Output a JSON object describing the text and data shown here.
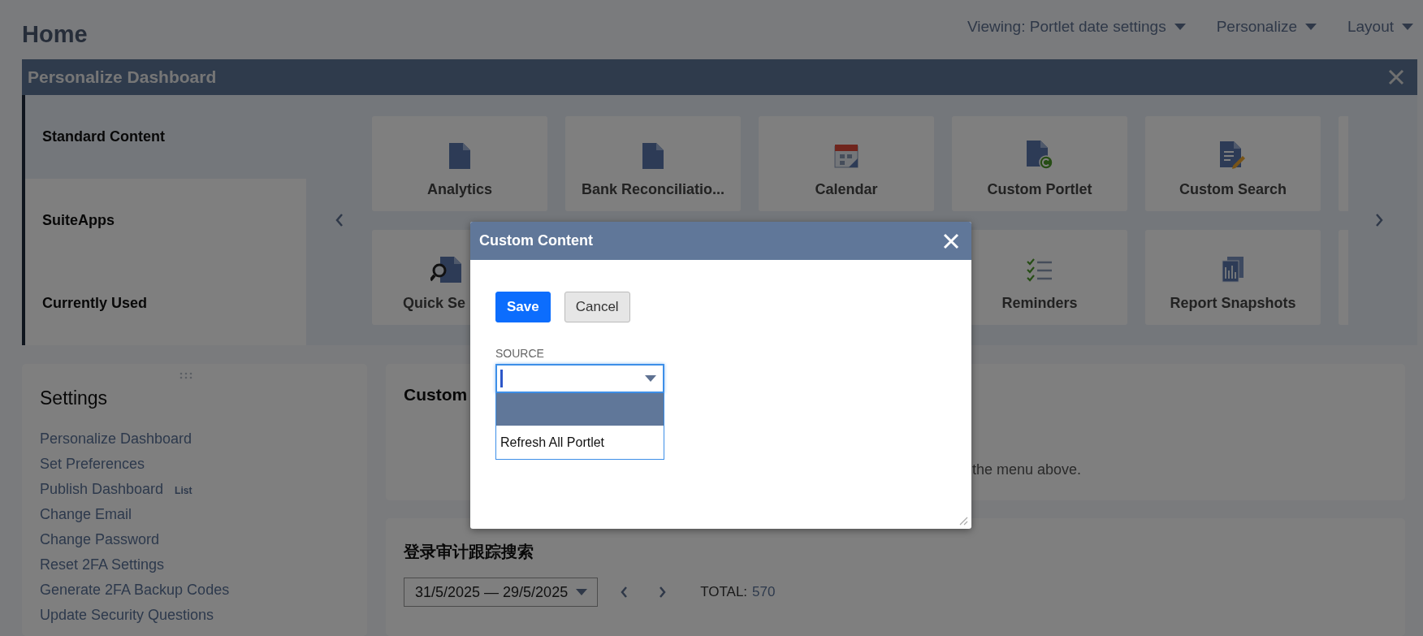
{
  "page": {
    "title": "Home",
    "menus": [
      {
        "label": "Viewing: Portlet date settings"
      },
      {
        "label": "Personalize"
      },
      {
        "label": "Layout"
      }
    ]
  },
  "personalize_panel": {
    "title": "Personalize Dashboard",
    "categories": [
      {
        "label": "Standard Content",
        "selected": true
      },
      {
        "label": "SuiteApps",
        "selected": false
      },
      {
        "label": "Currently Used",
        "selected": false
      }
    ],
    "tiles_row_1": [
      {
        "label": "Analytics",
        "kind": "document"
      },
      {
        "label": "Bank Reconciliatio...",
        "kind": "document"
      },
      {
        "label": "Calendar",
        "kind": "calendar"
      },
      {
        "label": "Custom Portlet",
        "kind": "badge"
      },
      {
        "label": "Custom Search",
        "kind": "pencil"
      }
    ],
    "tiles_row_2": [
      {
        "label": "Quick Se",
        "kind": "search"
      },
      {
        "label": "Reminders",
        "kind": "checklist"
      },
      {
        "label": "Report Snapshots",
        "kind": "stack"
      }
    ]
  },
  "settings_portlet": {
    "title": "Settings",
    "links": [
      {
        "label": "Personalize Dashboard"
      },
      {
        "label": "Set Preferences"
      },
      {
        "label": "Publish Dashboard",
        "tag": "List"
      },
      {
        "label": "Change Email"
      },
      {
        "label": "Change Password"
      },
      {
        "label": "Reset 2FA Settings"
      },
      {
        "label": "Generate 2FA Backup Codes"
      },
      {
        "label": "Update Security Questions"
      }
    ]
  },
  "custom_portlet": {
    "title": "Custom",
    "message": "the menu above."
  },
  "search_portlet": {
    "title": "登录审计跟踪搜索",
    "date_range": "31/5/2025 — 29/5/2025",
    "total_label": "TOTAL:",
    "total_value": "570"
  },
  "dialog": {
    "title": "Custom Content",
    "buttons": [
      {
        "label": "Save",
        "kind": "primary"
      },
      {
        "label": "Cancel",
        "kind": "secondary"
      }
    ],
    "field_label": "SOURCE",
    "options": [
      {
        "selected": true
      },
      {
        "label": "Refresh All Portlet",
        "selected": false
      }
    ]
  }
}
